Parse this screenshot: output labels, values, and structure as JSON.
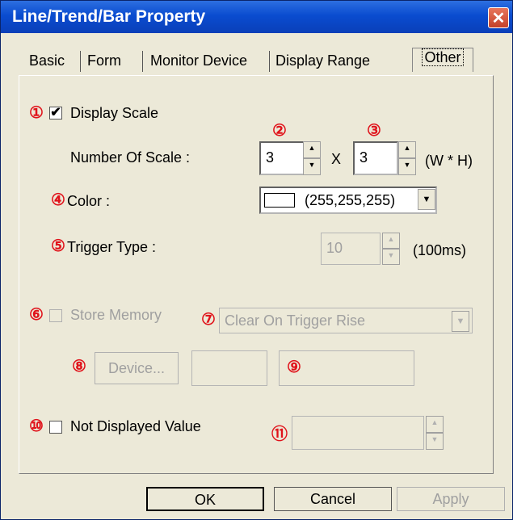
{
  "window": {
    "title": "Line/Trend/Bar Property",
    "close_glyph": "✕"
  },
  "tabs": [
    {
      "label": "Basic"
    },
    {
      "label": "Form"
    },
    {
      "label": "Monitor Device"
    },
    {
      "label": "Display Range"
    },
    {
      "label": "Other",
      "active": true
    }
  ],
  "markers": [
    "①",
    "②",
    "③",
    "④",
    "⑤",
    "⑥",
    "⑦",
    "⑧",
    "⑨",
    "⑩",
    "⑪"
  ],
  "display_scale": {
    "label": "Display Scale",
    "checked": true,
    "check_glyph": "✔"
  },
  "number_of_scale": {
    "label": "Number Of Scale :",
    "w_value": "3",
    "h_value": "3",
    "x_sep": "X",
    "unit": "(W * H)"
  },
  "color": {
    "label": "Color :",
    "value": "(255,255,255)",
    "swatch": "#ffffff"
  },
  "trigger_type": {
    "label": "Trigger Type :",
    "value": "10",
    "unit": "(100ms)"
  },
  "store_memory": {
    "label": "Store Memory",
    "checked": false,
    "option": "Clear On Trigger Rise"
  },
  "device": {
    "button_label": "Device...",
    "value1": "",
    "value2": ""
  },
  "not_displayed": {
    "label": "Not Displayed Value",
    "checked": false,
    "value": ""
  },
  "footer": {
    "ok": "OK",
    "cancel": "Cancel",
    "apply": "Apply"
  },
  "glyphs": {
    "up": "▲",
    "down": "▼"
  },
  "colors": {
    "title_bar": "#0a4cd0",
    "marker": "#e0131b",
    "disabled_text": "#a0a0a0",
    "dialog_bg": "#ece9d8"
  }
}
